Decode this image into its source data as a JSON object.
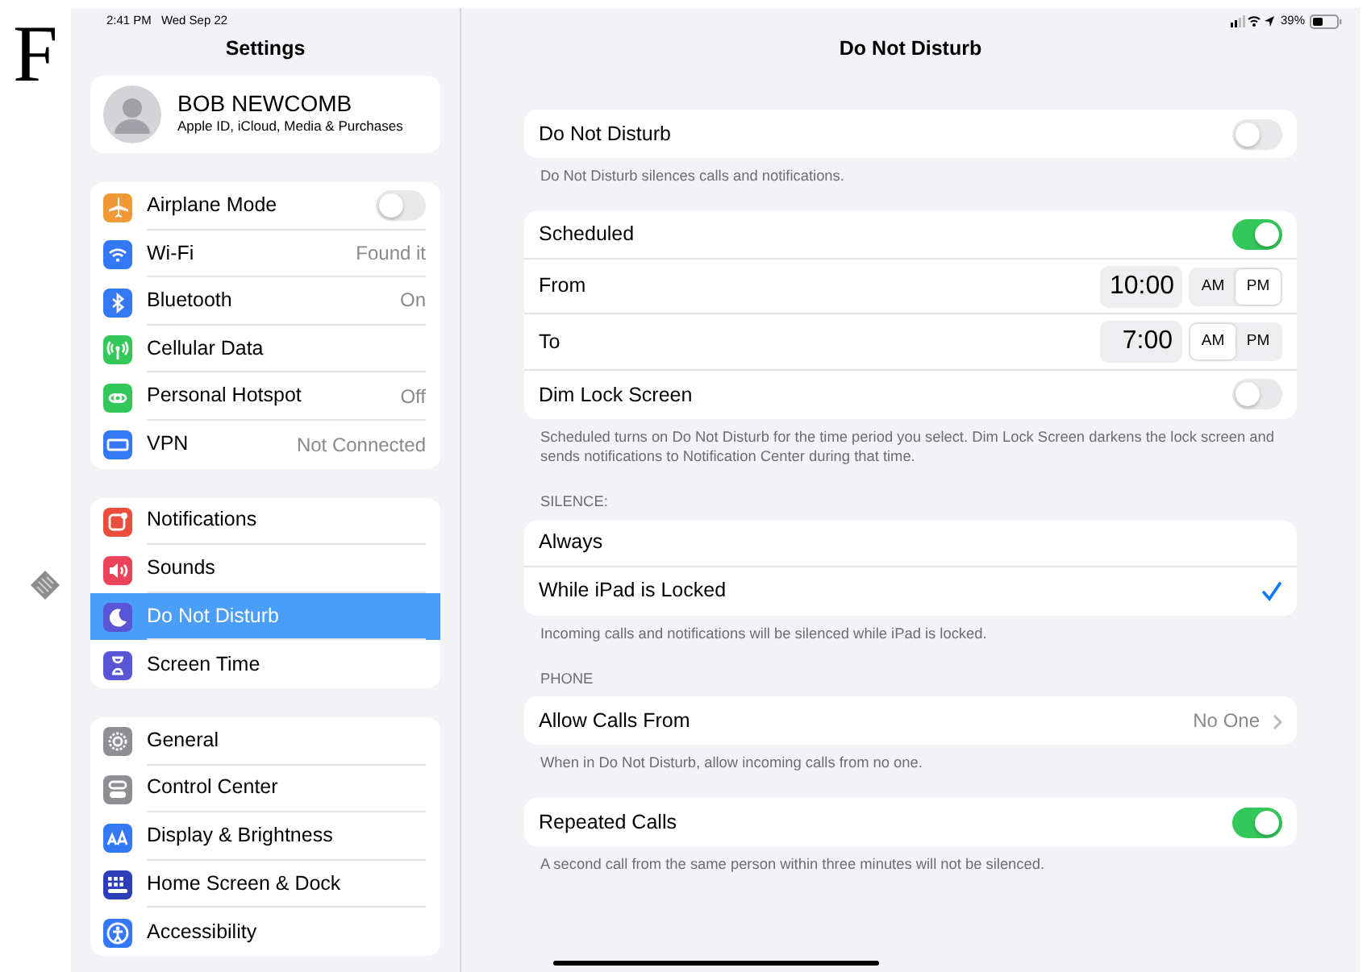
{
  "page_letter": "F",
  "status_bar": {
    "time": "2:41 PM",
    "date": "Wed Sep 22",
    "battery": "39%"
  },
  "sidebar": {
    "title": "Settings",
    "profile": {
      "name": "BOB NEWCOMB",
      "subtitle": "Apple ID, iCloud, Media & Purchases"
    },
    "groups": [
      [
        {
          "label": "Airplane Mode",
          "kind": "toggle",
          "on": false,
          "color": "#f09a37",
          "selected": false
        },
        {
          "label": "Wi-Fi",
          "kind": "value",
          "value": "Found it",
          "color": "#3478f6",
          "selected": false
        },
        {
          "label": "Bluetooth",
          "kind": "value",
          "value": "On",
          "color": "#3478f6",
          "selected": false
        },
        {
          "label": "Cellular Data",
          "kind": "plain",
          "color": "#34c759",
          "selected": false
        },
        {
          "label": "Personal Hotspot",
          "kind": "value",
          "value": "Off",
          "color": "#34c759",
          "selected": false
        },
        {
          "label": "VPN",
          "kind": "value",
          "value": "Not Connected",
          "color": "#3478f6",
          "selected": false
        }
      ],
      [
        {
          "label": "Notifications",
          "kind": "plain",
          "color": "#eb4e3d",
          "selected": false
        },
        {
          "label": "Sounds",
          "kind": "plain",
          "color": "#eb445a",
          "selected": false
        },
        {
          "label": "Do Not Disturb",
          "kind": "plain",
          "color": "#5856d6",
          "selected": true
        },
        {
          "label": "Screen Time",
          "kind": "plain",
          "color": "#5856d6",
          "selected": false
        }
      ],
      [
        {
          "label": "General",
          "kind": "plain",
          "color": "#8e8e93",
          "selected": false
        },
        {
          "label": "Control Center",
          "kind": "plain",
          "color": "#8e8e93",
          "selected": false
        },
        {
          "label": "Display & Brightness",
          "kind": "plain",
          "color": "#3478f6",
          "selected": false
        },
        {
          "label": "Home Screen & Dock",
          "kind": "plain",
          "color": "#2c3fb8",
          "selected": false
        },
        {
          "label": "Accessibility",
          "kind": "plain",
          "color": "#3478f6",
          "selected": false
        }
      ]
    ]
  },
  "detail": {
    "title": "Do Not Disturb",
    "sections": [
      {
        "rows": [
          {
            "kind": "toggle",
            "label": "Do Not Disturb",
            "on": false
          }
        ],
        "footer": "Do Not Disturb silences calls and notifications."
      },
      {
        "rows": [
          {
            "kind": "toggle",
            "label": "Scheduled",
            "on": true
          },
          {
            "kind": "time",
            "label": "From",
            "time": "10:00",
            "periods": [
              {
                "label": "AM",
                "selected": false
              },
              {
                "label": "PM",
                "selected": true
              }
            ]
          },
          {
            "kind": "time",
            "label": "To",
            "time": "7:00",
            "periods": [
              {
                "label": "AM",
                "selected": true
              },
              {
                "label": "PM",
                "selected": false
              }
            ]
          },
          {
            "kind": "toggle",
            "label": "Dim Lock Screen",
            "on": false
          }
        ],
        "footer": "Scheduled turns on Do Not Disturb for the time period you select. Dim Lock Screen darkens the lock screen and sends notifications to Notification Center during that time."
      },
      {
        "header": "SILENCE:",
        "rows": [
          {
            "kind": "check",
            "label": "Always",
            "selected": false
          },
          {
            "kind": "check",
            "label": "While iPad is Locked",
            "selected": true
          }
        ],
        "footer": "Incoming calls and notifications will be silenced while iPad is locked."
      },
      {
        "header": "PHONE",
        "rows": [
          {
            "kind": "link",
            "label": "Allow Calls From",
            "value": "No One"
          }
        ],
        "footer": "When in Do Not Disturb, allow incoming calls from no one."
      },
      {
        "rows": [
          {
            "kind": "toggle",
            "label": "Repeated Calls",
            "on": true
          }
        ],
        "footer": "A second call from the same person within three minutes will not be silenced."
      }
    ]
  }
}
